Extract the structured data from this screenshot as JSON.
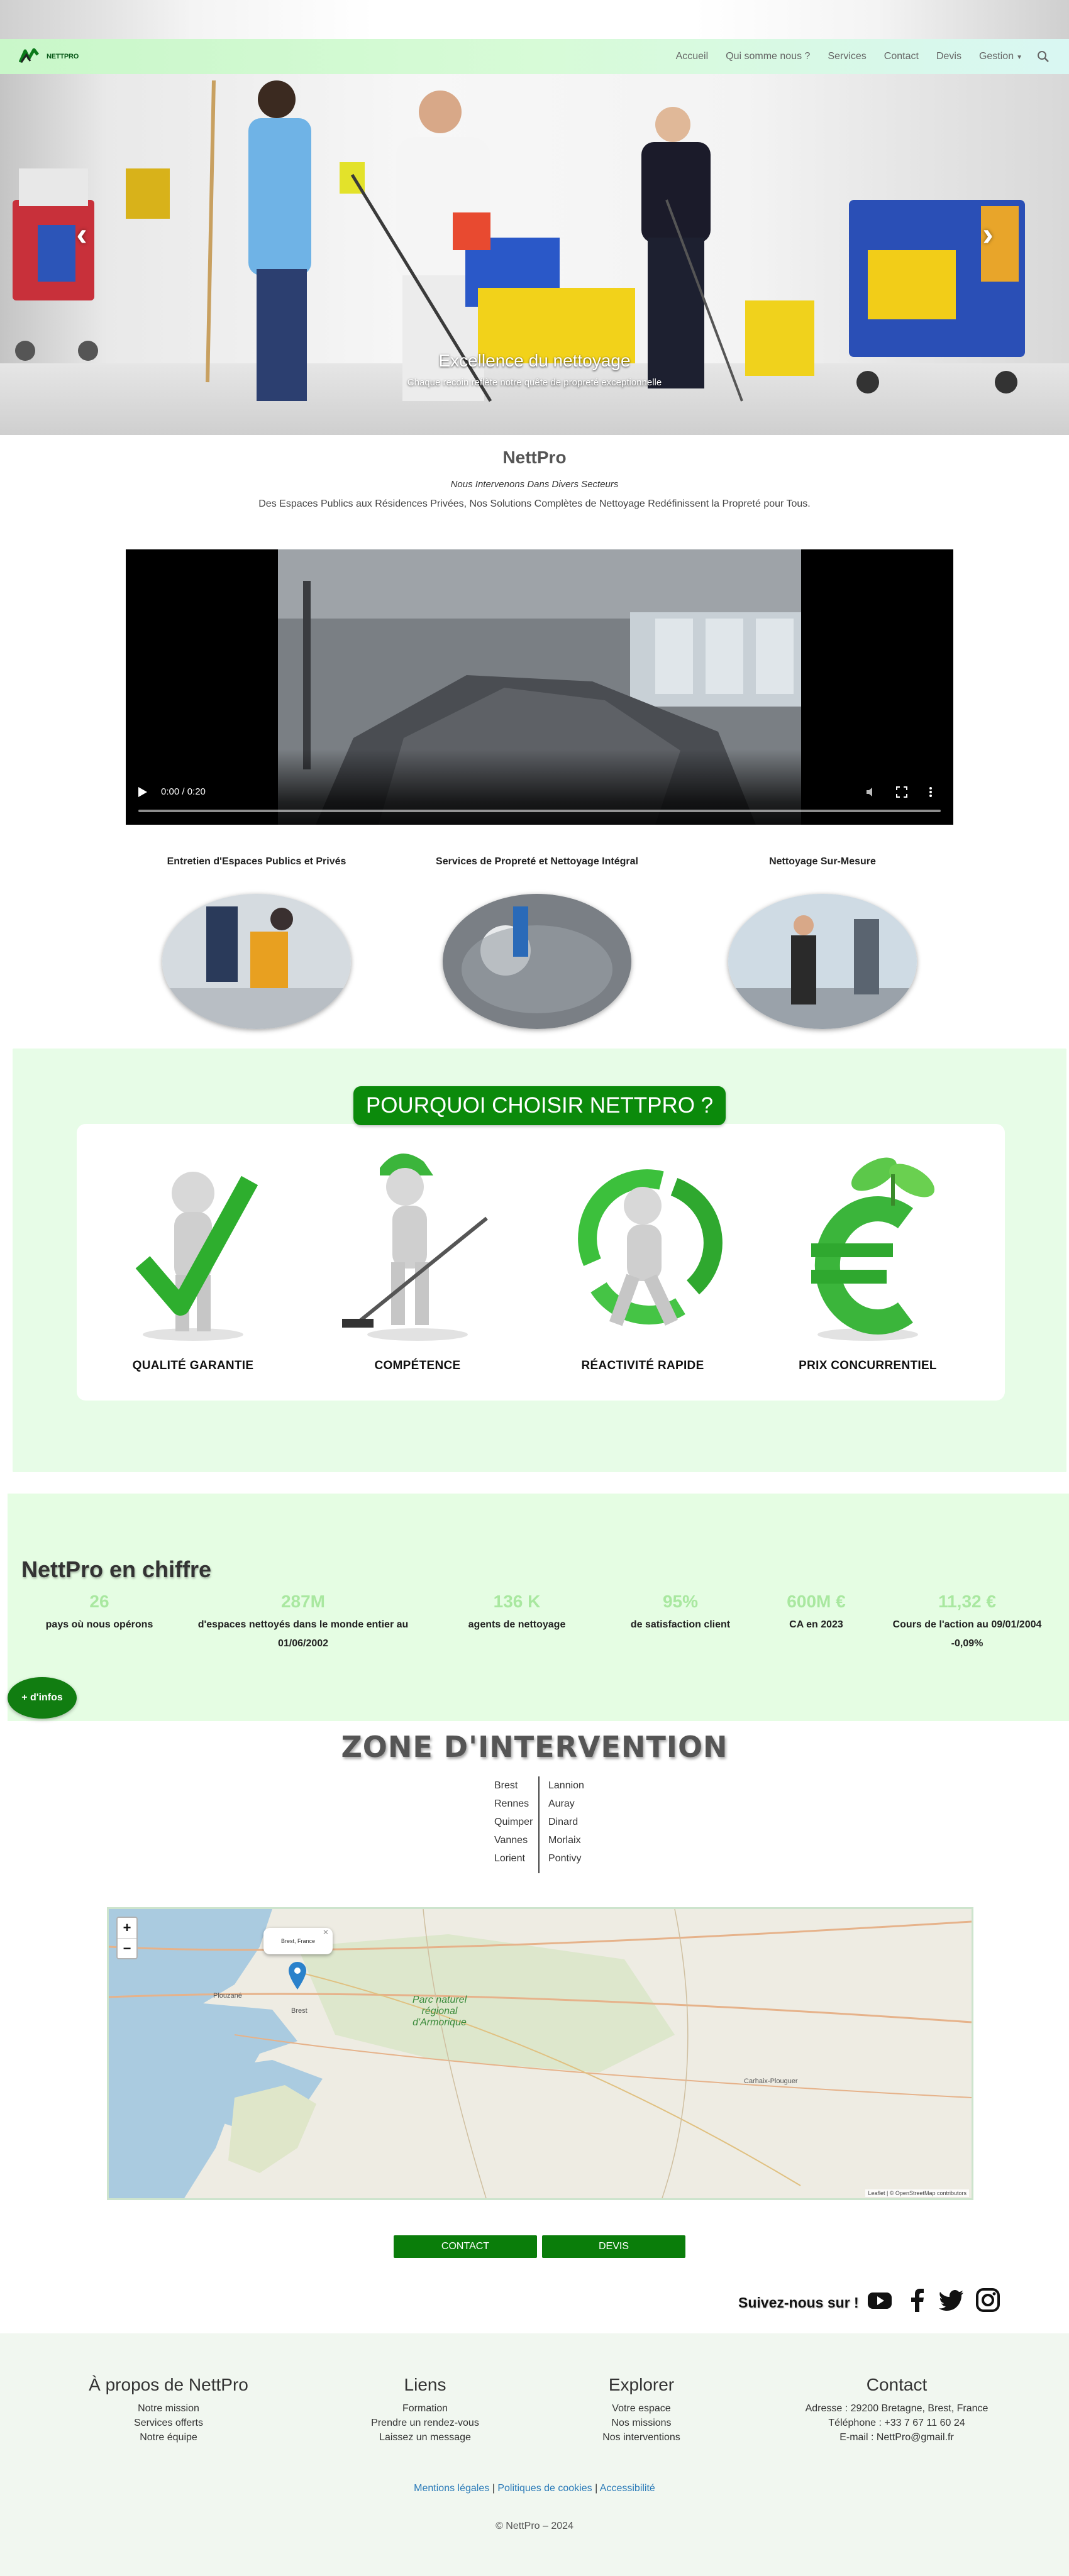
{
  "nav": {
    "logo_text": "NETTPRO",
    "items": [
      {
        "label": "Accueil"
      },
      {
        "label": "Qui somme nous ?"
      },
      {
        "label": "Services"
      },
      {
        "label": "Contact"
      },
      {
        "label": "Devis"
      },
      {
        "label": "Gestion"
      }
    ]
  },
  "hero": {
    "title": "Excellence du nettoyage",
    "subtitle": "Chaque recoin reflète notre quête de propreté exceptionnelle"
  },
  "intro": {
    "title": "NettPro",
    "subtitle": "Nous Intervenons Dans Divers Secteurs",
    "description": "Des Espaces Publics aux Résidences Privées, Nos Solutions Complètes de Nettoyage Redéfinissent la Propreté pour Tous."
  },
  "video": {
    "time": "0:00 / 0:20"
  },
  "services": [
    {
      "title": "Entretien d'Espaces Publics et Privés"
    },
    {
      "title": "Services de Propreté et Nettoyage Intégral"
    },
    {
      "title": "Nettoyage Sur-Mesure"
    }
  ],
  "why": {
    "title": "POURQUOI CHOISIR NETTPRO ?",
    "items": [
      {
        "label": "QUALITÉ GARANTIE"
      },
      {
        "label": "COMPÉTENCE"
      },
      {
        "label": "RÉACTIVITÉ RAPIDE"
      },
      {
        "label": "PRIX CONCURRENTIEL"
      }
    ]
  },
  "stats": {
    "title": "NettPro en chiffre",
    "items": [
      {
        "value": "26",
        "label": "pays où nous opérons"
      },
      {
        "value": "287M",
        "label": "d'espaces nettoyés dans le monde entier au 01/06/2002"
      },
      {
        "value": "136 K",
        "label": "agents de nettoyage"
      },
      {
        "value": "95%",
        "label": "de satisfaction client"
      },
      {
        "value": "600M €",
        "label": "CA en 2023"
      },
      {
        "value": "11,32 €",
        "label": "Cours de l'action au 09/01/2004 -0,09%"
      }
    ],
    "more_button": "+ d'infos"
  },
  "zone": {
    "title": "ZONE D'INTERVENTION",
    "left": [
      "Brest",
      "Rennes",
      "Quimper",
      "Vannes",
      "Lorient"
    ],
    "right": [
      "Lannion",
      "Auray",
      "Dinard",
      "Morlaix",
      "Pontivy"
    ]
  },
  "map": {
    "popup": "Brest, France",
    "park_label": "Parc naturel régional d'Armorique",
    "attribution": "Leaflet | © OpenStreetMap contributors"
  },
  "buttons": {
    "contact": "CONTACT",
    "devis": "DEVIS"
  },
  "social": {
    "label": "Suivez-nous sur !"
  },
  "footer": {
    "about": {
      "title": "À propos de NettPro",
      "links": [
        "Notre mission",
        "Services offerts",
        "Notre équipe"
      ]
    },
    "links": {
      "title": "Liens",
      "links": [
        "Formation",
        "Prendre un rendez-vous",
        "Laissez un message"
      ]
    },
    "explore": {
      "title": "Explorer",
      "links": [
        "Votre espace",
        "Nos missions",
        "Nos interventions"
      ]
    },
    "contact": {
      "title": "Contact",
      "lines": [
        "Adresse : 29200 Bretagne, Brest, France",
        "Téléphone : +33 7 67 11 60 24",
        "E-mail : NettPro@gmail.fr"
      ]
    },
    "legal": [
      "Mentions légales",
      "Politiques de cookies",
      "Accessibilité"
    ],
    "copyright": "© NettPro – 2024"
  },
  "colors": {
    "brand_green": "#0b8a0b",
    "stats_value": "#a9e8a0",
    "nav_bg": "#d7fbd7"
  }
}
